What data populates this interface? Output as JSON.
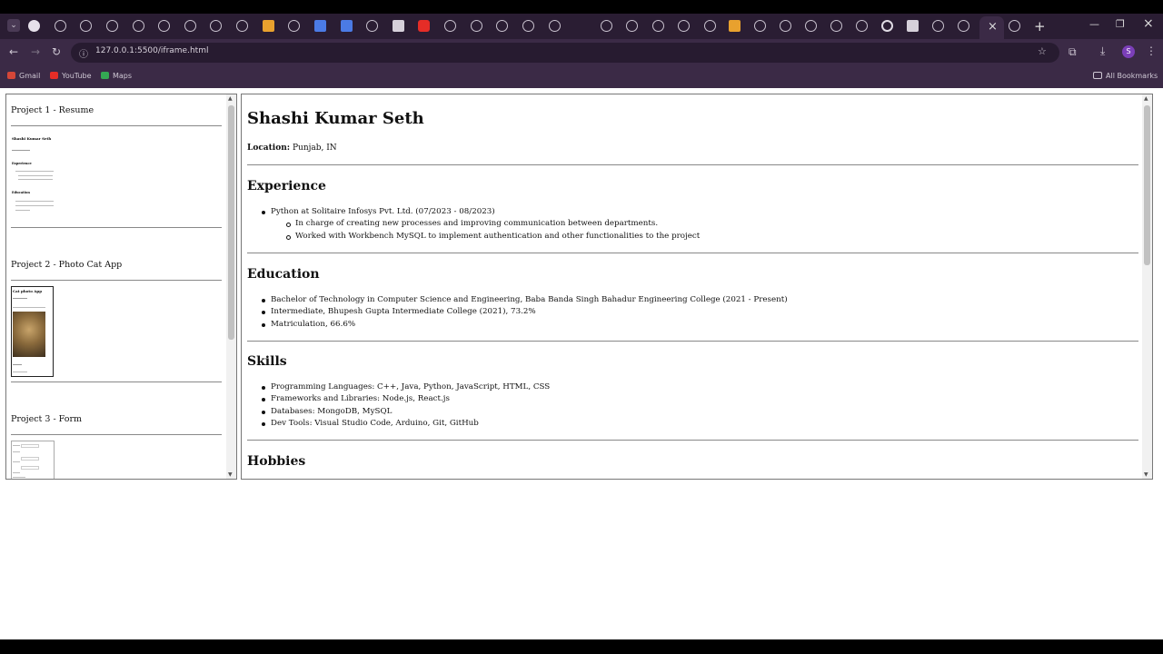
{
  "browser": {
    "url": "127.0.0.1:5500/iframe.html",
    "bookmarks": [
      "Gmail",
      "YouTube",
      "Maps"
    ],
    "all_bookmarks_label": "All Bookmarks",
    "profile_initial": "S",
    "new_tab_glyph": "+",
    "close_tab_glyph": "×"
  },
  "left_panel": {
    "projects": [
      {
        "title": "Project 1 - Resume"
      },
      {
        "title": "Project 2 - Photo Cat App"
      },
      {
        "title": "Project 3 - Form"
      }
    ],
    "thumb1": {
      "name": "Shashi Kumar Seth",
      "headings": [
        "Experience",
        "Education"
      ]
    },
    "thumb2": {
      "title": "Cat photo App"
    }
  },
  "resume": {
    "name": "Shashi Kumar Seth",
    "location_label": "Location:",
    "location_value": "Punjab, IN",
    "experience_heading": "Experience",
    "experience_item": "Python at Solitaire Infosys Pvt. Ltd. (07/2023 - 08/2023)",
    "experience_subitems": [
      "In charge of creating new processes and improving communication between departments.",
      "Worked with Workbench MySQL to implement authentication and other functionalities to the project"
    ],
    "education_heading": "Education",
    "education_items": [
      "Bachelor of Technology in Computer Science and Engineering, Baba Banda Singh Bahadur Engineering College (2021 - Present)",
      "Intermediate, Bhupesh Gupta Intermediate College (2021), 73.2%",
      "Matriculation, 66.6%"
    ],
    "skills_heading": "Skills",
    "skills_items": [
      "Programming Languages: C++, Java, Python, JavaScript, HTML, CSS",
      "Frameworks and Libraries: Node.js, React.js",
      "Databases: MongoDB, MySQL",
      "Dev Tools: Visual Studio Code, Arduino, Git, GitHub"
    ],
    "hobbies_heading": "Hobbies"
  }
}
